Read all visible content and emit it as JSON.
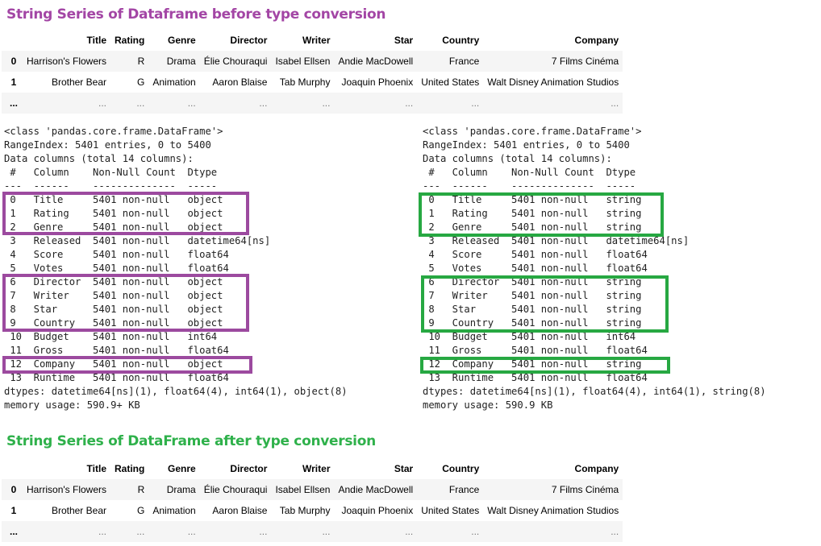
{
  "headings": {
    "before": "String Series of Dataframe before type conversion",
    "after": "String Series of DataFrame after type conversion"
  },
  "colors": {
    "before_accent": "#a346a5",
    "after_accent": "#2fb14b",
    "box_purple": "#9c4a9f",
    "box_green": "#27a842"
  },
  "table_before": {
    "columns": [
      "",
      "Title",
      "Rating",
      "Genre",
      "Director",
      "Writer",
      "Star",
      "Country",
      "Company"
    ],
    "rows": [
      [
        "0",
        "Harrison's Flowers",
        "R",
        "Drama",
        "Élie Chouraqui",
        "Isabel Ellsen",
        "Andie MacDowell",
        "France",
        "7 Films Cinéma"
      ],
      [
        "1",
        "Brother Bear",
        "G",
        "Animation",
        "Aaron Blaise",
        "Tab Murphy",
        "Joaquin Phoenix",
        "United States",
        "Walt Disney Animation Studios"
      ],
      [
        "...",
        "...",
        "...",
        "...",
        "...",
        "...",
        "...",
        "...",
        "..."
      ]
    ]
  },
  "table_after": {
    "columns": [
      "",
      "Title",
      "Rating",
      "Genre",
      "Director",
      "Writer",
      "Star",
      "Country",
      "Company"
    ],
    "rows": [
      [
        "0",
        "Harrison's Flowers",
        "R",
        "Drama",
        "Élie Chouraqui",
        "Isabel Ellsen",
        "Andie MacDowell",
        "France",
        "7 Films Cinéma"
      ],
      [
        "1",
        "Brother Bear",
        "G",
        "Animation",
        "Aaron Blaise",
        "Tab Murphy",
        "Joaquin Phoenix",
        "United States",
        "Walt Disney Animation Studios"
      ],
      [
        "...",
        "...",
        "...",
        "...",
        "...",
        "...",
        "...",
        "...",
        "..."
      ]
    ]
  },
  "info_before": [
    "<class 'pandas.core.frame.DataFrame'>",
    "RangeIndex: 5401 entries, 0 to 5400",
    "Data columns (total 14 columns):",
    " #   Column    Non-Null Count  Dtype",
    "---  ------    --------------  -----",
    " 0   Title     5401 non-null   object",
    " 1   Rating    5401 non-null   object",
    " 2   Genre     5401 non-null   object",
    " 3   Released  5401 non-null   datetime64[ns]",
    " 4   Score     5401 non-null   float64",
    " 5   Votes     5401 non-null   float64",
    " 6   Director  5401 non-null   object",
    " 7   Writer    5401 non-null   object",
    " 8   Star      5401 non-null   object",
    " 9   Country   5401 non-null   object",
    " 10  Budget    5401 non-null   int64",
    " 11  Gross     5401 non-null   float64",
    " 12  Company   5401 non-null   object",
    " 13  Runtime   5401 non-null   float64",
    "dtypes: datetime64[ns](1), float64(4), int64(1), object(8)",
    "memory usage: 590.9+ KB"
  ],
  "info_after": [
    "<class 'pandas.core.frame.DataFrame'>",
    "RangeIndex: 5401 entries, 0 to 5400",
    "Data columns (total 14 columns):",
    " #   Column    Non-Null Count  Dtype",
    "---  ------    --------------  -----",
    " 0   Title     5401 non-null   string",
    " 1   Rating    5401 non-null   string",
    " 2   Genre     5401 non-null   string",
    " 3   Released  5401 non-null   datetime64[ns]",
    " 4   Score     5401 non-null   float64",
    " 5   Votes     5401 non-null   float64",
    " 6   Director  5401 non-null   string",
    " 7   Writer    5401 non-null   string",
    " 8   Star      5401 non-null   string",
    " 9   Country   5401 non-null   string",
    " 10  Budget    5401 non-null   int64",
    " 11  Gross     5401 non-null   float64",
    " 12  Company   5401 non-null   string",
    " 13  Runtime   5401 non-null   float64",
    "dtypes: datetime64[ns](1), float64(4), int64(1), string(8)",
    "memory usage: 590.9 KB"
  ]
}
